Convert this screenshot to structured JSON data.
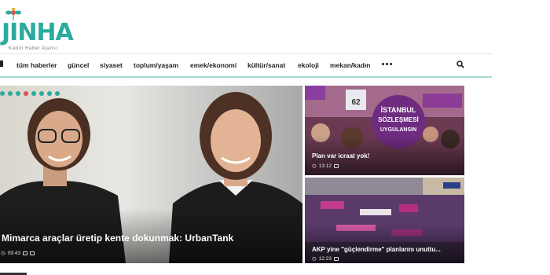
{
  "logo": {
    "word": "JINHA",
    "tagline": "Kadın Haber Ajansı",
    "flower_icon": "flower-icon"
  },
  "nav": {
    "items": [
      {
        "label": "tüm haberler"
      },
      {
        "label": "güncel"
      },
      {
        "label": "siyaset"
      },
      {
        "label": "toplum/yaşam"
      },
      {
        "label": "emek/ekonomi"
      },
      {
        "label": "kültür/sanat"
      },
      {
        "label": "ekoloji"
      },
      {
        "label": "mekan/kadın"
      }
    ],
    "more_icon": "more-icon",
    "search_icon": "search-icon"
  },
  "hero": {
    "title": "Mimarca araçlar üretip kente dokunmak: UrbanTank",
    "time": "09:43",
    "active_dot": 3
  },
  "cards": [
    {
      "title": "Plan var icraat yok!",
      "time": "13:12",
      "sign_text_1": "İSTANBUL",
      "sign_text_2": "SÖZLEŞMESİ",
      "sign_text_3": "UYGULANSIN",
      "sign_text_4": "62"
    },
    {
      "title": "AKP yine \"güçlendirme\" planlarını unuttu...",
      "time": "12:23"
    }
  ],
  "colors": {
    "brand": "#2bab9e",
    "accent": "#d9534f",
    "nav_rule": "#a9dcd6"
  }
}
